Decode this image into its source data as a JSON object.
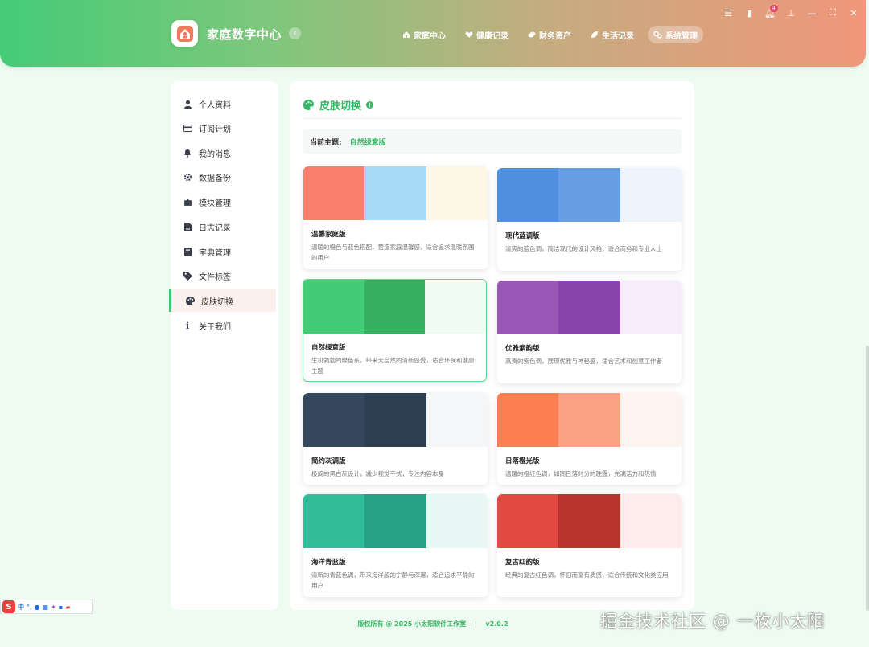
{
  "header": {
    "app_title": "家庭数字中心",
    "nav": [
      {
        "label": "家庭中心",
        "icon": "home-icon"
      },
      {
        "label": "健康记录",
        "icon": "heart-icon"
      },
      {
        "label": "财务资产",
        "icon": "coins-icon"
      },
      {
        "label": "生活记录",
        "icon": "leaf-icon"
      },
      {
        "label": "系统管理",
        "icon": "gears-icon",
        "active": true
      }
    ],
    "notification_count": "4",
    "window_controls": [
      "sliders-icon",
      "lock-icon",
      "bell-icon",
      "pin-icon",
      "minimize-icon",
      "maximize-icon",
      "close-icon"
    ]
  },
  "sidebar": {
    "items": [
      {
        "label": "个人资料",
        "icon": "user-icon"
      },
      {
        "label": "订阅计划",
        "icon": "credit-card-icon"
      },
      {
        "label": "我的消息",
        "icon": "bell-icon"
      },
      {
        "label": "数据备份",
        "icon": "gear-icon"
      },
      {
        "label": "模块管理",
        "icon": "puzzle-icon"
      },
      {
        "label": "日志记录",
        "icon": "file-icon"
      },
      {
        "label": "字典管理",
        "icon": "book-icon"
      },
      {
        "label": "文件标签",
        "icon": "tag-icon"
      },
      {
        "label": "皮肤切换",
        "icon": "palette-icon",
        "active": true
      },
      {
        "label": "关于我们",
        "icon": "info-icon"
      }
    ]
  },
  "main": {
    "title": "皮肤切换",
    "current_label": "当前主题:",
    "current_value": "自然绿意版",
    "themes": [
      {
        "name": "温馨家庭版",
        "desc": "温暖的橙色与蓝色搭配，营造家庭温馨感，适合追求温暖氛围的用户",
        "colors": [
          "#fb7f6f",
          "#a7dbf5",
          "#fdf7e5"
        ]
      },
      {
        "name": "现代蓝调版",
        "desc": "清爽的蓝色调，简洁现代的设计风格，适合商务和专业人士",
        "colors": [
          "#4f8fdf",
          "#679ee2",
          "#eff4fc"
        ]
      },
      {
        "name": "自然绿意版",
        "desc": "生机勃勃的绿色系，带来大自然的清新感受，适合环保和健康主题",
        "colors": [
          "#43cc76",
          "#35b061",
          "#f0fbf3"
        ],
        "selected": true
      },
      {
        "name": "优雅紫韵版",
        "desc": "高贵的紫色调，展现优雅与神秘感，适合艺术和创意工作者",
        "colors": [
          "#9a57b5",
          "#8c44ad",
          "#f5edf9"
        ]
      },
      {
        "name": "简约灰调版",
        "desc": "极简的黑白灰设计，减少视觉干扰，专注内容本身",
        "colors": [
          "#34475c",
          "#2d3e50",
          "#f4f6f8"
        ]
      },
      {
        "name": "日落橙光版",
        "desc": "温暖的橙红色调，如同日落时分的晚霞，充满活力和热情",
        "colors": [
          "#fc7f53",
          "#fca183",
          "#fdf4ef"
        ]
      },
      {
        "name": "海洋青蓝版",
        "desc": "清新的青蓝色调，带来海洋般的宁静与深邃，适合追求平静的用户",
        "colors": [
          "#31bc9a",
          "#25a185",
          "#e8f7f4"
        ]
      },
      {
        "name": "复古红韵版",
        "desc": "经典的复古红色调，怀旧而富有质感，适合传统和文化类应用",
        "colors": [
          "#e24a43",
          "#b9342d",
          "#fdeceb"
        ]
      }
    ]
  },
  "footer": {
    "copyright": "版权所有 @ 2025 小太阳软件工作室",
    "separator": "|",
    "version": "v2.0.2"
  },
  "ime": {
    "lang": "中",
    "badge": "S"
  },
  "watermark": "掘金技术社区 @ 一枚小太阳",
  "colors": {
    "accent": "#35b863",
    "header_start": "#45cb77",
    "header_end": "#f0967b"
  }
}
